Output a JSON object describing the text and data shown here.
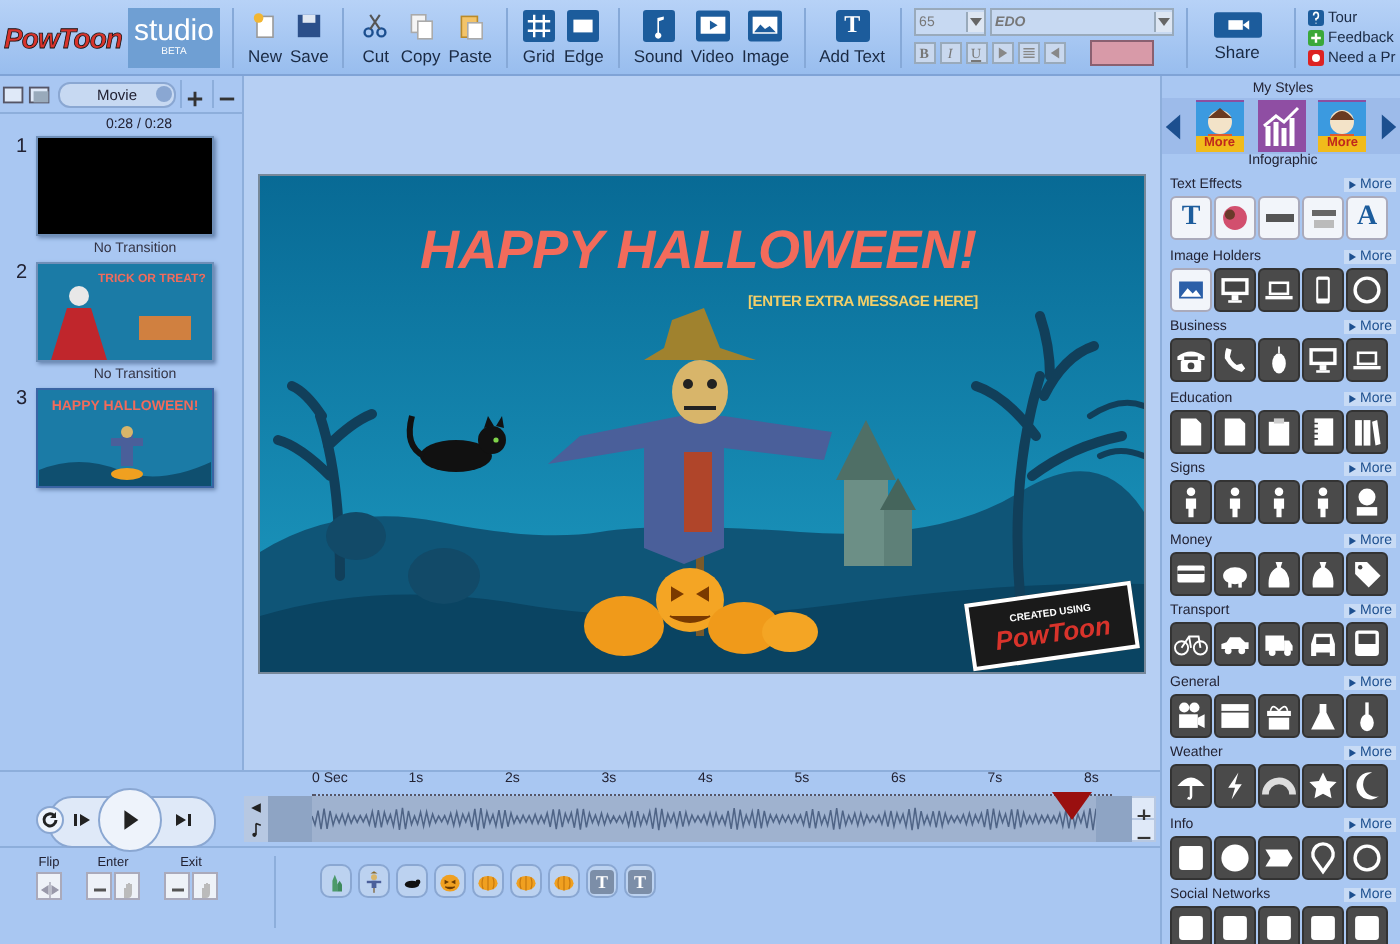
{
  "toolbar": {
    "logo": "PowToon",
    "studio": "studio",
    "beta": "BETA",
    "groups": [
      [
        {
          "label": "New",
          "kind": "new"
        },
        {
          "label": "Save",
          "kind": "save"
        }
      ],
      [
        {
          "label": "Cut",
          "kind": "cut"
        },
        {
          "label": "Copy",
          "kind": "copy"
        },
        {
          "label": "Paste",
          "kind": "paste"
        }
      ],
      [
        {
          "label": "Grid",
          "kind": "grid"
        },
        {
          "label": "Edge",
          "kind": "edge"
        }
      ],
      [
        {
          "label": "Sound",
          "kind": "sound"
        },
        {
          "label": "Video",
          "kind": "video"
        },
        {
          "label": "Image",
          "kind": "image"
        }
      ],
      [
        {
          "label": "Add Text",
          "kind": "text",
          "glyph": "T"
        }
      ]
    ],
    "font_size": "65",
    "font": "EDO",
    "format": [
      {
        "kind": "bold",
        "glyph": "B"
      },
      {
        "kind": "italic",
        "glyph": "I"
      },
      {
        "kind": "underline",
        "glyph": "U"
      },
      {
        "kind": "align-left"
      },
      {
        "kind": "align-center"
      },
      {
        "kind": "align-right"
      }
    ],
    "share": "Share",
    "help": [
      {
        "label": "Tour",
        "kind": "question"
      },
      {
        "label": "Feedback",
        "kind": "plus"
      },
      {
        "label": "Need a Pr",
        "kind": "star"
      }
    ]
  },
  "slides_panel": {
    "view": "Movie",
    "time": "0:28 / 0:28",
    "slides": [
      {
        "number": "1",
        "selected": false,
        "kind": "blank"
      },
      {
        "number": "2",
        "selected": false,
        "kind": "trick",
        "title": "TRICK OR TREAT?"
      },
      {
        "number": "3",
        "selected": true,
        "kind": "halloween",
        "title": "HAPPY HALLOWEEN!"
      }
    ],
    "transitions": [
      "No Transition",
      "No Transition"
    ]
  },
  "slide": {
    "title": "HAPPY HALLOWEEN!",
    "subtitle": "[ENTER EXTRA MESSAGE HERE]",
    "badge_top": "CREATED USING",
    "badge_logo": "PowToon"
  },
  "styles": {
    "title": "My Styles",
    "items": [
      {
        "label": "More",
        "selected": false,
        "kind": "man"
      },
      {
        "label": "Infographic",
        "selected": true,
        "kind": "infographic"
      },
      {
        "label": "More",
        "selected": false,
        "kind": "woman"
      }
    ]
  },
  "categories": [
    {
      "name": "Text Effects",
      "more": "More",
      "tiles": [
        {
          "kind": "glyph",
          "glyph": "T"
        },
        {
          "kind": "splash"
        },
        {
          "kind": "word"
        },
        {
          "kind": "word2"
        },
        {
          "kind": "glyph",
          "glyph": "A"
        }
      ]
    },
    {
      "name": "Image Holders",
      "more": "More",
      "tiles": [
        {
          "kind": "photo"
        },
        {
          "kind": "monitor"
        },
        {
          "kind": "laptop"
        },
        {
          "kind": "tablet"
        },
        {
          "kind": "ring"
        }
      ]
    },
    {
      "name": "Business",
      "more": "More",
      "tiles": [
        {
          "kind": "deskphone"
        },
        {
          "kind": "handset"
        },
        {
          "kind": "mouse"
        },
        {
          "kind": "monitor"
        },
        {
          "kind": "laptop"
        }
      ]
    },
    {
      "name": "Education",
      "more": "More",
      "tiles": [
        {
          "kind": "page"
        },
        {
          "kind": "page"
        },
        {
          "kind": "clipboard"
        },
        {
          "kind": "notebook"
        },
        {
          "kind": "books"
        }
      ]
    },
    {
      "name": "Signs",
      "more": "More",
      "tiles": [
        {
          "kind": "person"
        },
        {
          "kind": "person"
        },
        {
          "kind": "person"
        },
        {
          "kind": "person"
        },
        {
          "kind": "bust"
        }
      ]
    },
    {
      "name": "Money",
      "more": "More",
      "tiles": [
        {
          "kind": "card"
        },
        {
          "kind": "piggy"
        },
        {
          "kind": "bag"
        },
        {
          "kind": "bag"
        },
        {
          "kind": "tag"
        }
      ]
    },
    {
      "name": "Transport",
      "more": "More",
      "tiles": [
        {
          "kind": "bike"
        },
        {
          "kind": "car"
        },
        {
          "kind": "truck"
        },
        {
          "kind": "carfront"
        },
        {
          "kind": "bus"
        }
      ]
    },
    {
      "name": "General",
      "more": "More",
      "tiles": [
        {
          "kind": "camera"
        },
        {
          "kind": "clapper"
        },
        {
          "kind": "gift"
        },
        {
          "kind": "flask"
        },
        {
          "kind": "guitar"
        }
      ]
    },
    {
      "name": "Weather",
      "more": "More",
      "tiles": [
        {
          "kind": "umbrella"
        },
        {
          "kind": "bolt"
        },
        {
          "kind": "rainbow"
        },
        {
          "kind": "star"
        },
        {
          "kind": "moon"
        }
      ]
    },
    {
      "name": "Info",
      "more": "More",
      "tiles": [
        {
          "kind": "square"
        },
        {
          "kind": "circle"
        },
        {
          "kind": "banner"
        },
        {
          "kind": "pin"
        },
        {
          "kind": "ring"
        }
      ]
    },
    {
      "name": "Social Networks",
      "more": "More",
      "tiles": [
        {
          "kind": "square"
        },
        {
          "kind": "square"
        },
        {
          "kind": "square"
        },
        {
          "kind": "square"
        },
        {
          "kind": "square"
        }
      ]
    }
  ],
  "timeline": {
    "ticks": [
      "0 Sec",
      "1s",
      "2s",
      "3s",
      "4s",
      "5s",
      "6s",
      "7s",
      "8s"
    ],
    "playhead": {
      "level": 0.97
    },
    "effects": [
      {
        "label": "Flip",
        "kind": "flip"
      },
      {
        "label": "Enter",
        "kind": "pair"
      },
      {
        "label": "Exit",
        "kind": "pair"
      }
    ],
    "objects": [
      {
        "kind": "castle"
      },
      {
        "kind": "scarecrow"
      },
      {
        "kind": "cat"
      },
      {
        "kind": "jack"
      },
      {
        "kind": "pumpkin"
      },
      {
        "kind": "pumpkin"
      },
      {
        "kind": "pumpkin"
      },
      {
        "kind": "text",
        "glyph": "T"
      },
      {
        "kind": "text",
        "glyph": "T"
      }
    ]
  }
}
